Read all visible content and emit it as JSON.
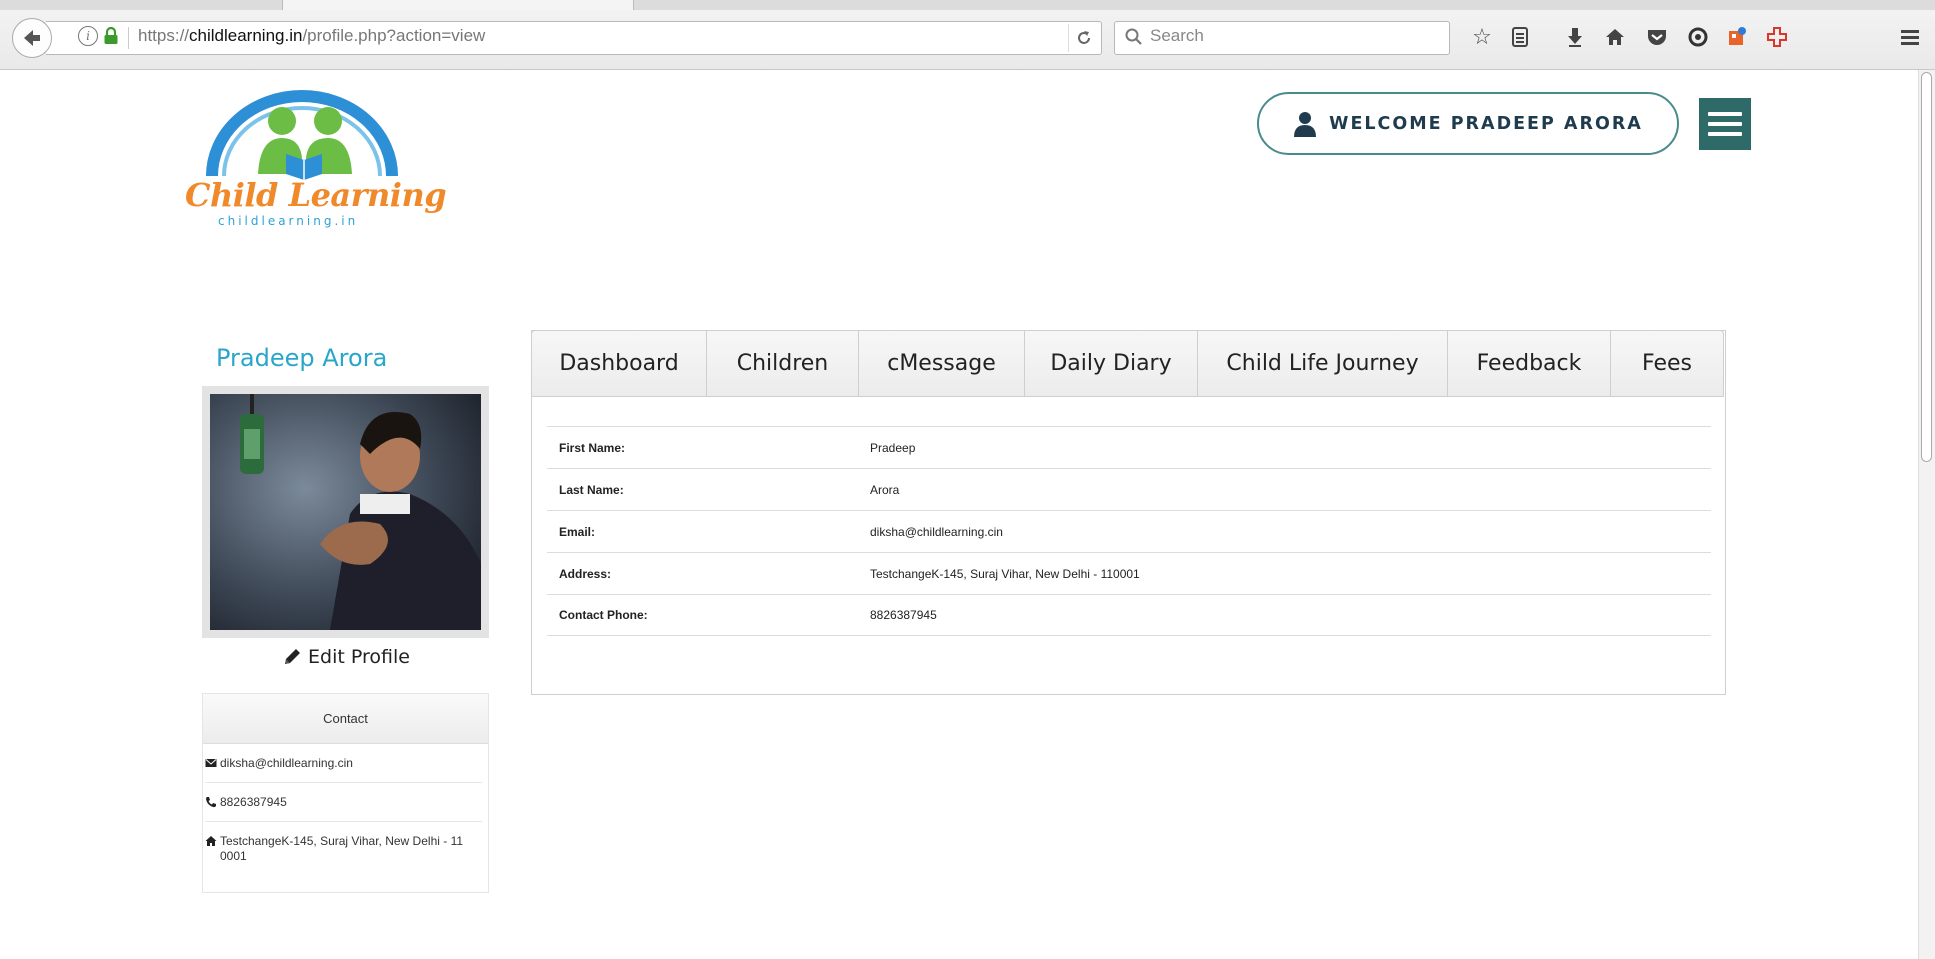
{
  "browser": {
    "url_prefix": "https://",
    "url_domain": "childlearning.in",
    "url_path": "/profile.php?action=view",
    "search_placeholder": "Search"
  },
  "header": {
    "logo_text": "Child Learning",
    "logo_subtext": "childlearning.in",
    "welcome_label": "WELCOME PRADEEP ARORA"
  },
  "profile": {
    "name": "Pradeep Arora",
    "edit_label": "Edit Profile"
  },
  "contact": {
    "heading": "Contact",
    "email": "diksha@childlearning.cin",
    "phone": "8826387945",
    "address": "TestchangeK-145, Suraj Vihar, New Delhi - 11 0001"
  },
  "tabs": [
    "Dashboard",
    "Children",
    "cMessage",
    "Daily Diary",
    "Child Life Journey",
    "Feedback",
    "Fees"
  ],
  "details": [
    {
      "label": "First Name:",
      "value": "Pradeep"
    },
    {
      "label": "Last Name:",
      "value": "Arora"
    },
    {
      "label": "Email:",
      "value": "diksha@childlearning.cin"
    },
    {
      "label": "Address:",
      "value": "TestchangeK-145, Suraj Vihar, New Delhi - 110001"
    },
    {
      "label": "Contact Phone:",
      "value": "8826387945"
    }
  ],
  "colors": {
    "accent_teal": "#2d6a68",
    "name_blue": "#2aa6c9",
    "logo_orange": "#f0892a"
  }
}
